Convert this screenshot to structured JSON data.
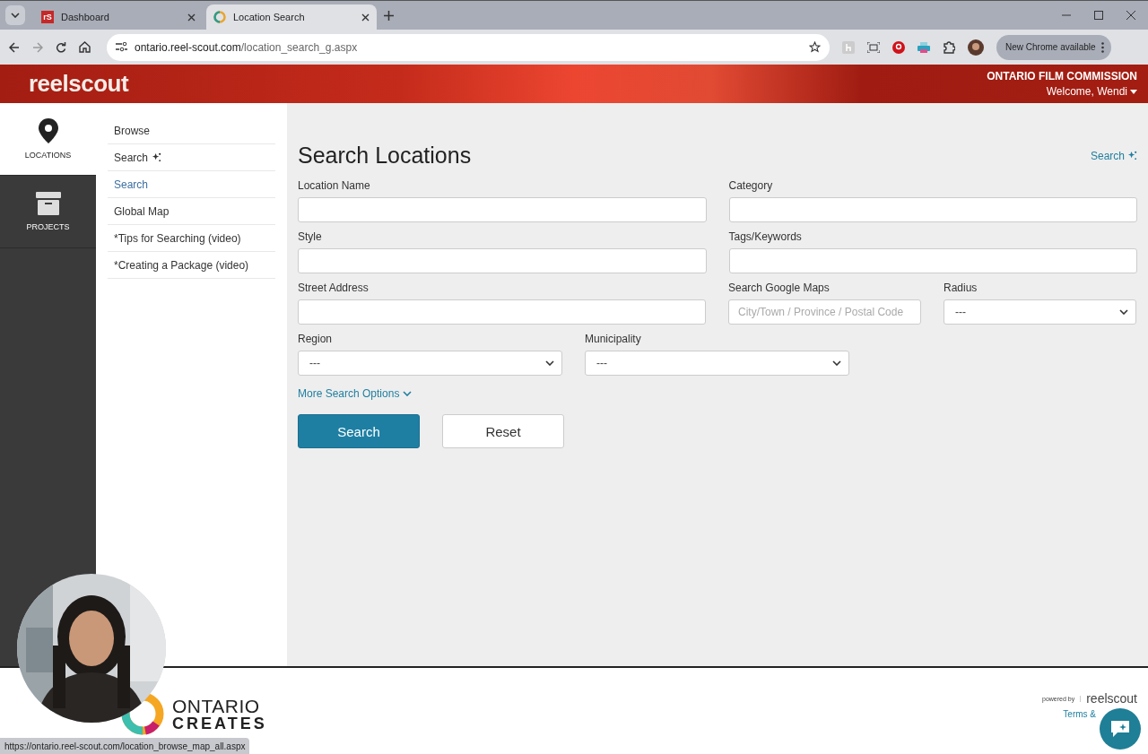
{
  "browser": {
    "tabs": [
      {
        "title": "Dashboard",
        "selected": false,
        "favicon_text": "rS"
      },
      {
        "title": "Location Search",
        "selected": true
      }
    ],
    "url_host": "ontario.reel-scout.com",
    "url_path": "/location_search_g.aspx",
    "update_label": "New Chrome available",
    "status_url": "https://ontario.reel-scout.com/location_browse_map_all.aspx"
  },
  "header": {
    "logo": "reelscout",
    "organization": "ONTARIO FILM COMMISSION",
    "welcome": "Welcome, Wendi"
  },
  "rail": [
    {
      "label": "LOCATIONS",
      "selected": true,
      "kind": "pin"
    },
    {
      "label": "PROJECTS",
      "selected": false,
      "kind": "box"
    }
  ],
  "submenu": [
    {
      "label": "Browse",
      "selected": false,
      "sparkle": false
    },
    {
      "label": "Search",
      "selected": false,
      "sparkle": true
    },
    {
      "label": "Search",
      "selected": true,
      "sparkle": false
    },
    {
      "label": "Global Map",
      "selected": false,
      "sparkle": false
    },
    {
      "label": "*Tips for Searching (video)",
      "selected": false,
      "sparkle": false
    },
    {
      "label": "*Creating a Package (video)",
      "selected": false,
      "sparkle": false
    }
  ],
  "main": {
    "title": "Search Locations",
    "ai_link": "Search",
    "rows": [
      [
        {
          "label": "Location Name",
          "kind": "input"
        },
        {
          "label": "Category",
          "kind": "input"
        }
      ],
      [
        {
          "label": "Style",
          "kind": "input"
        },
        {
          "label": "Tags/Keywords",
          "kind": "input"
        }
      ],
      [
        {
          "label": "Street Address",
          "kind": "input"
        },
        {
          "label": "Search Google Maps",
          "kind": "input",
          "placeholder": "City/Town / Province / Postal Code"
        },
        {
          "label": "Radius",
          "kind": "select",
          "value": "---"
        }
      ],
      [
        {
          "label": "Region",
          "kind": "select",
          "value": "---"
        },
        {
          "label": "Municipality",
          "kind": "select",
          "value": "---"
        }
      ]
    ],
    "more_options": "More Search Options",
    "buttons": [
      {
        "label": "Search",
        "kind": "primary"
      },
      {
        "label": "Reset",
        "kind": "secondary"
      }
    ]
  },
  "footer": {
    "logo_top": "ONTARIO",
    "logo_bottom": "CREATES",
    "powered_by": "powered by",
    "brand": "reelscout",
    "terms": "Terms &"
  }
}
